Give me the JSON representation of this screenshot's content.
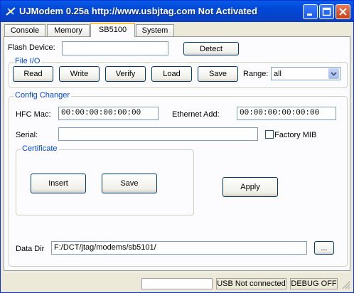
{
  "window": {
    "title": "UJModem 0.25a http://www.usbjtag.com  Not Activated"
  },
  "tabs": [
    {
      "label": "Console",
      "active": false
    },
    {
      "label": "Memory",
      "active": false
    },
    {
      "label": "SB5100",
      "active": true
    },
    {
      "label": "System",
      "active": false
    }
  ],
  "flash": {
    "label": "Flash Device:",
    "value": "",
    "detect_label": "Detect"
  },
  "file_io": {
    "title": "File I/O",
    "buttons": [
      "Read",
      "Write",
      "Verify",
      "Load",
      "Save"
    ],
    "range_label": "Range:",
    "range_value": "all"
  },
  "config": {
    "title": "Config Changer",
    "hfc_label": "HFC Mac:",
    "hfc_value": "00:00:00:00:00:00",
    "eth_label": "Ethernet Add:",
    "eth_value": "00:00:00:00:00:00",
    "serial_label": "Serial:",
    "serial_value": "",
    "factory_label": "Factory MIB",
    "certificate": {
      "title": "Certificate",
      "insert_label": "Insert",
      "save_label": "Save"
    },
    "apply_label": "Apply"
  },
  "data_dir": {
    "label": "Data Dir",
    "value": "F:/DCT/jtag/modems/sb5101/",
    "browse_label": "..."
  },
  "status": {
    "field1": "",
    "usb": "USB Not connected",
    "debug": "DEBUG OFF"
  }
}
